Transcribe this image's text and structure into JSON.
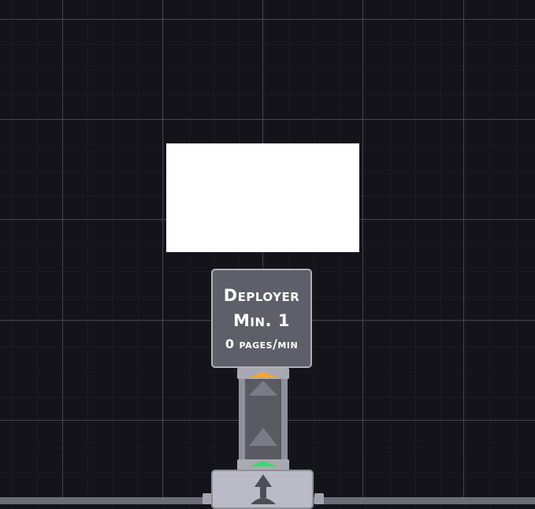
{
  "deployer": {
    "name": "Deployer",
    "level": "Min. 1",
    "rate": "0 pages/min"
  },
  "icons": {
    "conveyor": "conveyor-arrow-icon",
    "base_arrow": "up-arrow-icon"
  },
  "colors": {
    "background": "#141319",
    "grid_line": "#46454f",
    "deployer_fill": "#5e5f68",
    "deployer_border": "#aeb0bb",
    "input_indicator": "#f4a43a",
    "output_indicator": "#3fd66a"
  }
}
